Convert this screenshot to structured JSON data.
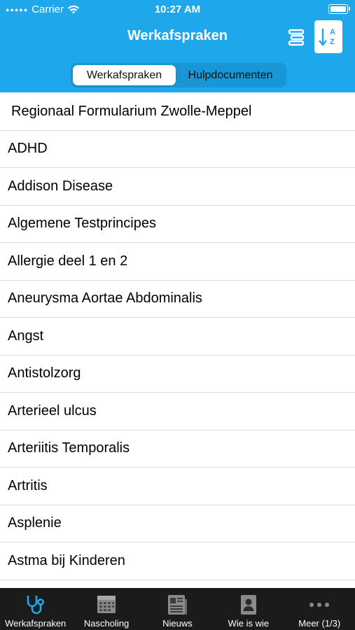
{
  "status": {
    "carrier": "Carrier",
    "time": "10:27 AM"
  },
  "header": {
    "title": "Werkafspraken",
    "list_icon": "list-icon",
    "sort_icon": "sort-az-icon"
  },
  "segment": {
    "items": [
      "Werkafspraken",
      "Hulpdocumenten"
    ],
    "selected": "Werkafspraken"
  },
  "list": {
    "items": [
      "Regionaal Formularium Zwolle-Meppel",
      "ADHD",
      "Addison Disease",
      "Algemene Testprincipes",
      "Allergie deel 1 en 2",
      "Aneurysma Aortae Abdominalis",
      "Angst",
      "Antistolzorg",
      "Arterieel ulcus",
      "Arteriitis Temporalis",
      "Artritis",
      "Asplenie",
      "Astma bij Kinderen"
    ]
  },
  "tabbar": {
    "items": [
      {
        "label": "Werkafspraken",
        "icon": "stethoscope-icon"
      },
      {
        "label": "Nascholing",
        "icon": "calendar-icon"
      },
      {
        "label": "Nieuws",
        "icon": "newspaper-icon"
      },
      {
        "label": "Wie is wie",
        "icon": "contact-card-icon"
      },
      {
        "label": "Meer (1/3)",
        "icon": "more-icon"
      }
    ],
    "active_color": "#1ea7ea"
  },
  "colors": {
    "header": "#1ea7ea",
    "tabbar": "#1b1b1b"
  }
}
